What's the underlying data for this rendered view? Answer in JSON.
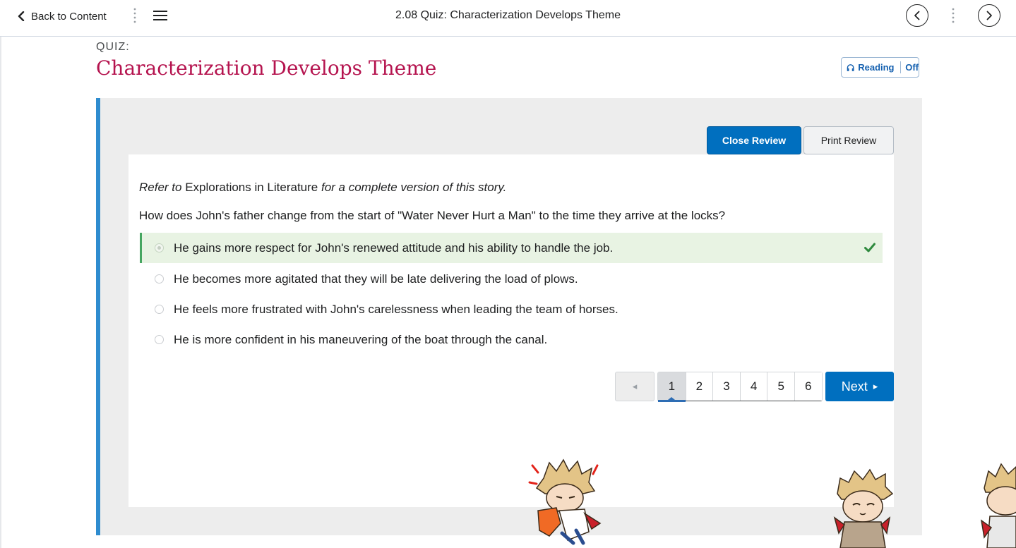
{
  "topbar": {
    "back_label": "Back to Content",
    "title": "2.08 Quiz: Characterization Develops Theme"
  },
  "header": {
    "quiz_label": "QUIZ:",
    "title": "Characterization Develops Theme"
  },
  "reading": {
    "label": "Reading",
    "state": "Off"
  },
  "review": {
    "close_label": "Close Review",
    "print_label": "Print Review"
  },
  "question": {
    "refer_prefix": "Refer to",
    "refer_book": " Explorations in Literature ",
    "refer_suffix": "for a complete version of this story.",
    "text": "How does John's father change from the start of \"Water Never Hurt a Man\" to the time they arrive at the locks?",
    "choices": [
      {
        "text": "He gains more respect for John's renewed attitude and his ability to handle the job.",
        "correct": true
      },
      {
        "text": "He becomes more agitated that they will be late delivering the load of plows.",
        "correct": false
      },
      {
        "text": "He feels more frustrated with John's carelessness when leading the team of horses.",
        "correct": false
      },
      {
        "text": "He is more confident in his maneuvering of the boat through the canal.",
        "correct": false
      }
    ]
  },
  "pager": {
    "prev_symbol": "◂",
    "pages": [
      "1",
      "2",
      "3",
      "4",
      "5",
      "6"
    ],
    "current": "1",
    "next_label": "Next",
    "next_symbol": "▸"
  },
  "colors": {
    "accent": "#006fbf",
    "title": "#b5144f",
    "correct_bg": "#e8f3e3",
    "correct_mark": "#2f8a3e",
    "panel_border": "#2e8ccf"
  }
}
